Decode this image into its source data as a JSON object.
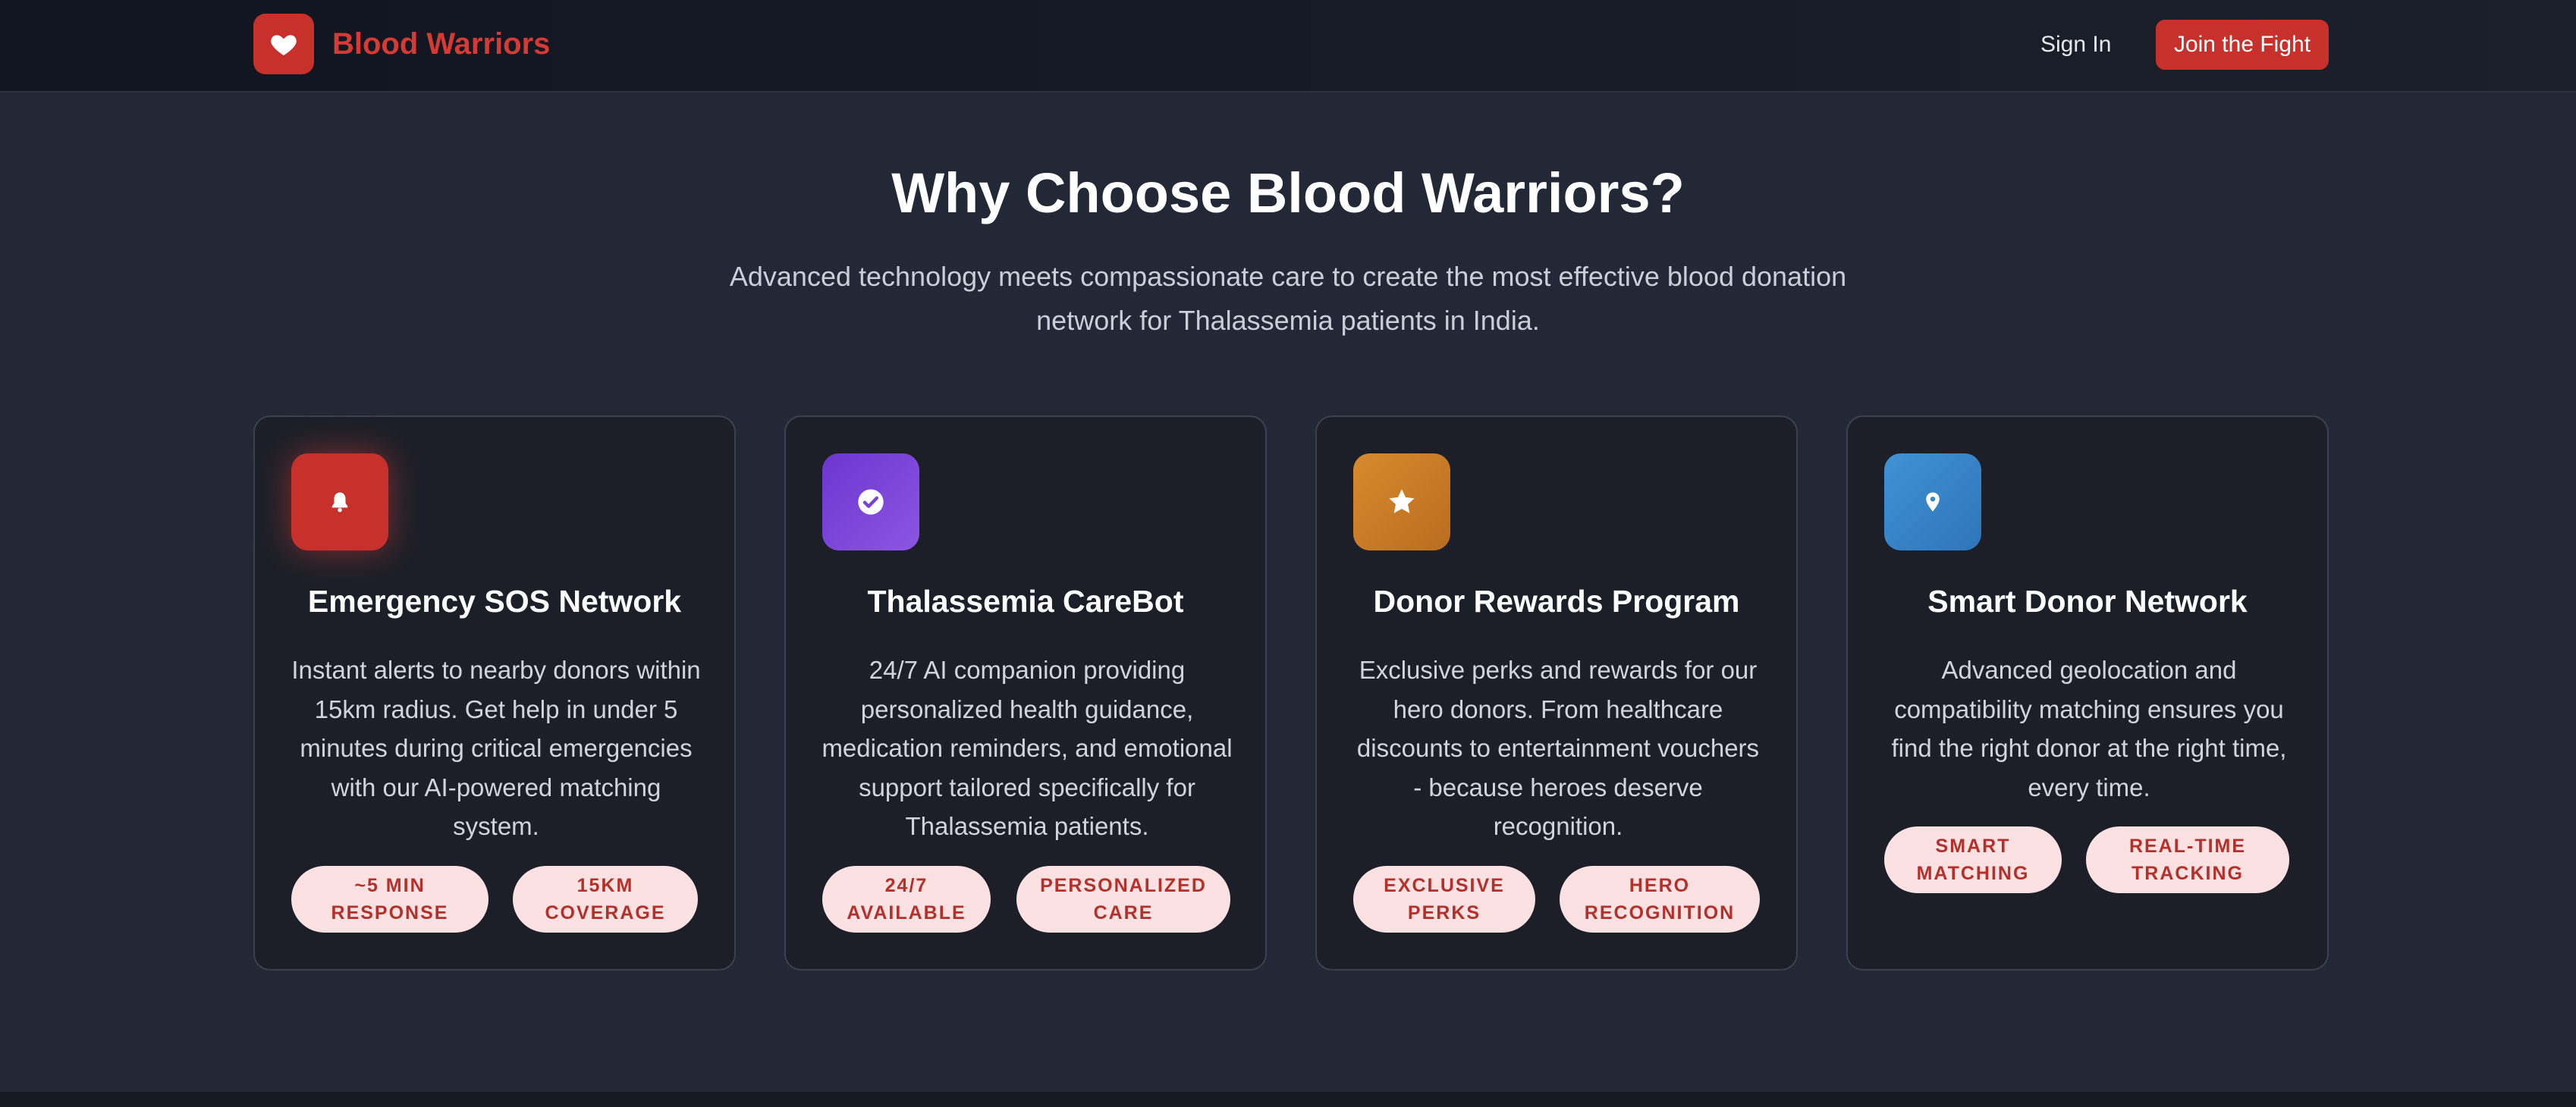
{
  "nav": {
    "brand_name": "Blood Warriors",
    "sign_in": "Sign In",
    "join": "Join the Fight"
  },
  "section": {
    "title": "Why Choose Blood Warriors?",
    "subtitle_line1": "Advanced technology meets compassionate care to create the most effective blood donation",
    "subtitle_line2": "network for Thalassemia patients in India."
  },
  "features": [
    {
      "icon": "bell-icon",
      "icon_color": "#c8302b",
      "title": "Emergency SOS Network",
      "description": "Instant alerts to nearby donors within 15km radius. Get help in under 5 minutes during critical emergencies with our AI-powered matching system.",
      "tags": [
        "~5 MIN\nRESPONSE",
        "15KM\nCOVERAGE"
      ]
    },
    {
      "icon": "check-circle-icon",
      "icon_color": "#7a43d6",
      "title": "Thalassemia CareBot",
      "description": "24/7 AI companion providing personalized health guidance, medication reminders, and emotional support tailored specifically for Thalassemia patients.",
      "tags": [
        "24/7\nAVAILABLE",
        "PERSONALIZED\nCARE"
      ]
    },
    {
      "icon": "star-icon",
      "icon_color": "#c77a25",
      "title": "Donor Rewards Program",
      "description": "Exclusive perks and rewards for our hero donors. From healthcare discounts to entertainment vouchers - because heroes deserve recognition.",
      "tags": [
        "EXCLUSIVE\nPERKS",
        "HERO\nRECOGNITION"
      ]
    },
    {
      "icon": "map-pin-icon",
      "icon_color": "#3a86c8",
      "title": "Smart Donor Network",
      "description": "Advanced geolocation and compatibility matching ensures you find the right donor at the right time, every time.",
      "tags": [
        "SMART\nMATCHING",
        "REAL-TIME\nTRACKING"
      ]
    }
  ]
}
